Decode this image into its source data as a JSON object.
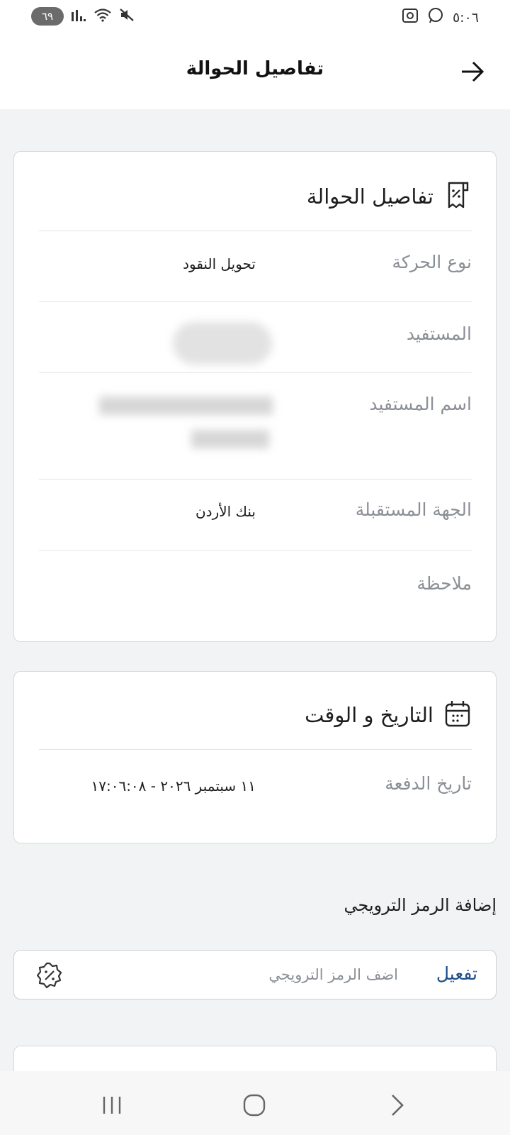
{
  "status_bar": {
    "battery": "٦٩",
    "time": "٥:٠٦"
  },
  "header": {
    "title": "تفاصيل الحوالة",
    "back_icon": "arrow-right-icon"
  },
  "transfer_details": {
    "title": "تفاصيل الحوالة",
    "icon": "receipt-percent-icon",
    "rows": [
      {
        "label": "نوع الحركة",
        "value": "تحويل النقود"
      },
      {
        "label": "المستفيد",
        "value": ""
      },
      {
        "label": "اسم المستفيد",
        "value": ""
      },
      {
        "label": "الجهة المستقبلة",
        "value": "بنك الأردن"
      },
      {
        "label": "ملاحظة",
        "value": ""
      }
    ]
  },
  "date_time": {
    "title": "التاريخ و الوقت",
    "icon": "calendar-icon",
    "rows": [
      {
        "label": "تاريخ الدفعة",
        "value": "١١ سبتمبر ٢٠٢٦ - ١٧:٠٦:٠٨"
      }
    ]
  },
  "promo": {
    "section_title": "إضافة الرمز الترويجي",
    "activate_label": "تفعيل",
    "placeholder": "اضف الرمز الترويجي",
    "value": "",
    "icon": "discount-badge-icon"
  },
  "nav": {
    "recents_icon": "recents-icon",
    "home_icon": "home-icon",
    "back_icon": "chevron-back-icon"
  },
  "colors": {
    "background": "#f2f3f5",
    "card": "#ffffff",
    "label": "#8b8f96",
    "accent": "#1d4e89"
  }
}
